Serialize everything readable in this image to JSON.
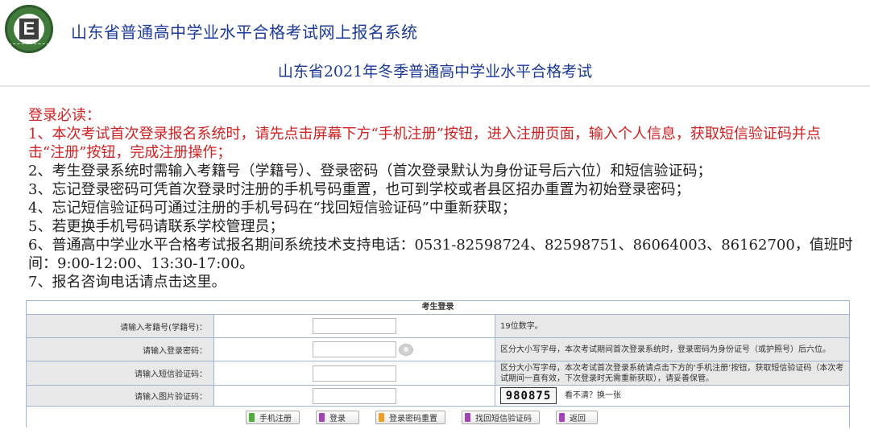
{
  "header": {
    "site_title": "山东省普通高中学业水平合格考试网上报名系统",
    "logo_letter": "E",
    "exam_title": "山东省2021年冬季普通高中学业水平合格考试"
  },
  "notice": {
    "heading": "登录必读：",
    "items": [
      "1、本次考试首次登录报名系统时，请先点击屏幕下方“手机注册”按钮，进入注册页面，输入个人信息，获取短信验证码并点击“注册”按钮，完成注册操作；",
      "2、考生登录系统时需输入考籍号（学籍号）、登录密码（首次登录默认为身份证号后六位）和短信验证码；",
      "3、忘记登录密码可凭首次登录时注册的手机号码重置，也可到学校或者县区招办重置为初始登录密码；",
      "4、忘记短信验证码可通过注册的手机号码在“找回短信验证码”中重新获取；",
      "5、若更换手机号码请联系学校管理员；",
      "6、普通高中学业水平合格考试报名期间系统技术支持电话：0531-82598724、82598751、86064003、86162700，值班时间：9:00-12:00、13:30-17:00。",
      "7、报名咨询电话请点击这里。"
    ]
  },
  "login": {
    "title": "考生登录",
    "rows": [
      {
        "label": "请输入考籍号(学籍号)：",
        "hint": "19位数字。"
      },
      {
        "label": "请输入登录密码：",
        "hint": "区分大小写字母，本次考试期间首次登录系统时，登录密码为身份证号（或护照号）后六位。"
      },
      {
        "label": "请输入短信验证码：",
        "hint": "区分大小写字母，本次考试首次登录系统请点击下方的‘手机注册’按钮，获取短信验证码（本次考试期间一直有效，下次登录时无需重新获取），请妥善保管。"
      },
      {
        "label": "请输入图片验证码：",
        "hint": "看不清？换一张"
      }
    ],
    "captcha_text": "980875"
  },
  "buttons": [
    {
      "label": "手机注册",
      "icon": "green"
    },
    {
      "label": "登录",
      "icon": "purple"
    },
    {
      "label": "登录密码重置",
      "icon": "orange"
    },
    {
      "label": "找回短信验证码",
      "icon": "purple"
    },
    {
      "label": "返回",
      "icon": "purple"
    }
  ],
  "colors": {
    "title_blue": "#1b3a9a",
    "notice_red": "#d42020",
    "table_border": "#9fb4cf",
    "cell_gray": "#e8e8e8"
  }
}
